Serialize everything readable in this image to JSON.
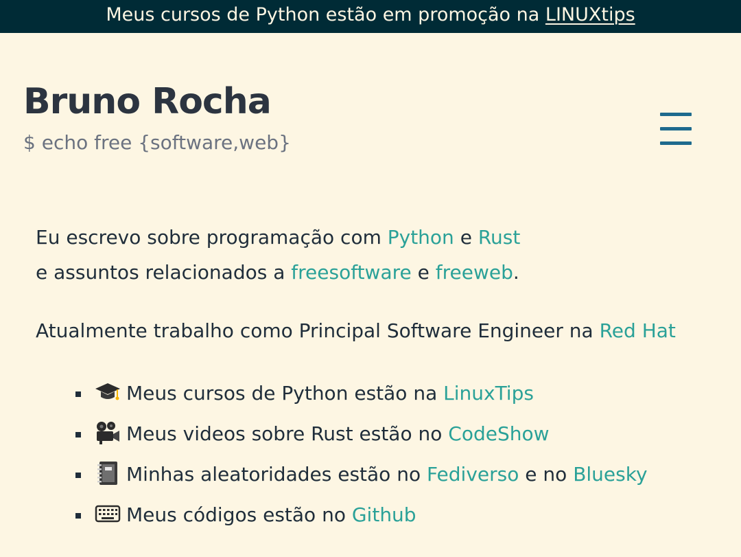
{
  "promo": {
    "text": "Meus cursos de Python estão em promoção na ",
    "link": "LINUXtips"
  },
  "header": {
    "title": "Bruno Rocha",
    "subtitle": "$ echo free {software,web}",
    "menu_icon": "hamburger-menu-icon"
  },
  "intro": {
    "line1_text": "Eu escrevo sobre programação com ",
    "python": "Python",
    "and1": " e ",
    "rust": "Rust",
    "line2_text": "e assuntos relacionados a ",
    "freesoftware": "freesoftware",
    "and2": " e ",
    "freeweb": "freeweb",
    "period": "."
  },
  "work": {
    "text": "Atualmente trabalho como Principal Software Engineer na ",
    "company": "Red Hat"
  },
  "links": [
    {
      "icon": "graduation-cap-icon",
      "text": "Meus cursos de Python estão na ",
      "link": "LinuxTips"
    },
    {
      "icon": "movie-camera-icon",
      "text": "Meus videos sobre Rust estão no ",
      "link": "CodeShow"
    },
    {
      "icon": "notebook-icon",
      "text": "Minhas aleatoridades estão no ",
      "link": "Fediverso",
      "middle": " e no ",
      "link2": "Bluesky"
    },
    {
      "icon": "keyboard-icon",
      "text": "Meus códigos estão no ",
      "link": "Github"
    }
  ],
  "colors": {
    "background": "#fdf6e3",
    "promo_bar": "#002b36",
    "link": "#2aa198",
    "menu_icon": "#1e6a8d",
    "text": "#1f2d3a"
  }
}
